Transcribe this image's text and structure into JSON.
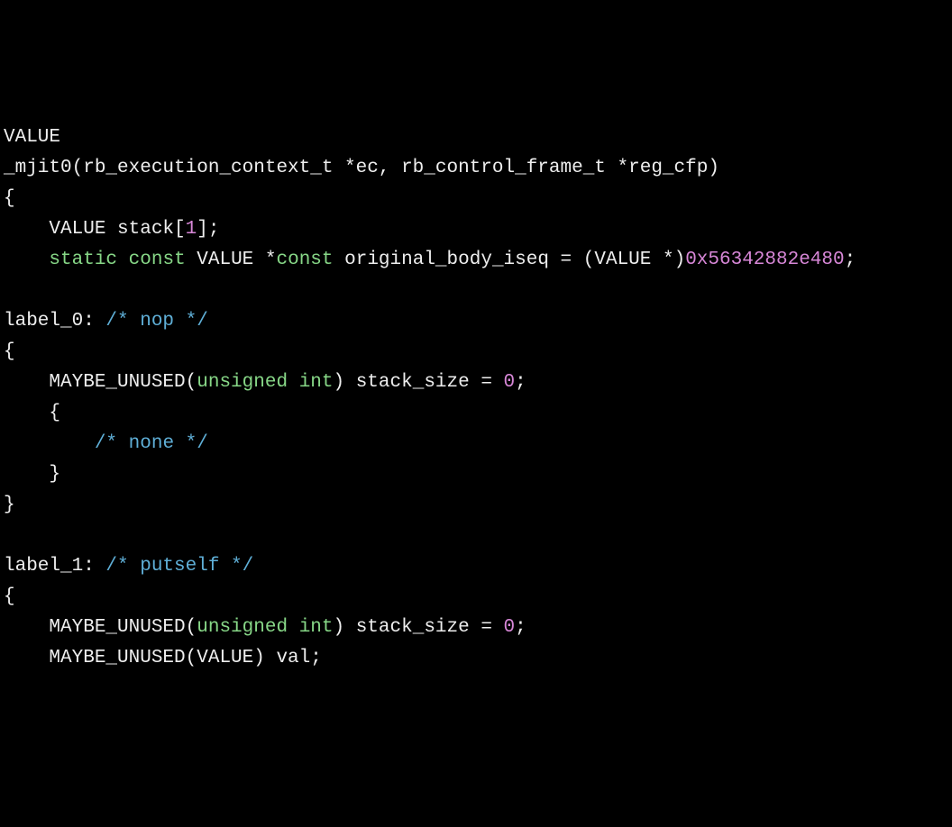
{
  "code": {
    "l0_t0": "VALUE",
    "l1_t0": "_mjit0(rb_execution_context_t *ec, rb_control_frame_t *reg_cfp)",
    "l2_t0": "{",
    "l3_t0": "    VALUE stack[",
    "l3_t1": "1",
    "l3_t2": "];",
    "l4_t0": "    ",
    "l4_t1": "static",
    "l4_t2": " ",
    "l4_t3": "const",
    "l4_t4": " VALUE *",
    "l4_t5": "const",
    "l4_t6": " original_body_iseq = (VALUE *)",
    "l4_t7": "0x56342882e480",
    "l4_t8": ";",
    "l5_t0": "",
    "l6_t0": "label_0: ",
    "l6_t1": "/* nop */",
    "l7_t0": "{",
    "l8_t0": "    MAYBE_UNUSED(",
    "l8_t1": "unsigned",
    "l8_t2": " ",
    "l8_t3": "int",
    "l8_t4": ") stack_size = ",
    "l8_t5": "0",
    "l8_t6": ";",
    "l9_t0": "    {",
    "l10_t0": "        ",
    "l10_t1": "/* none */",
    "l11_t0": "    }",
    "l12_t0": "}",
    "l13_t0": "",
    "l14_t0": "label_1: ",
    "l14_t1": "/* putself */",
    "l15_t0": "{",
    "l16_t0": "    MAYBE_UNUSED(",
    "l16_t1": "unsigned",
    "l16_t2": " ",
    "l16_t3": "int",
    "l16_t4": ") stack_size = ",
    "l16_t5": "0",
    "l16_t6": ";",
    "l17_t0": "    MAYBE_UNUSED(VALUE) val;"
  }
}
